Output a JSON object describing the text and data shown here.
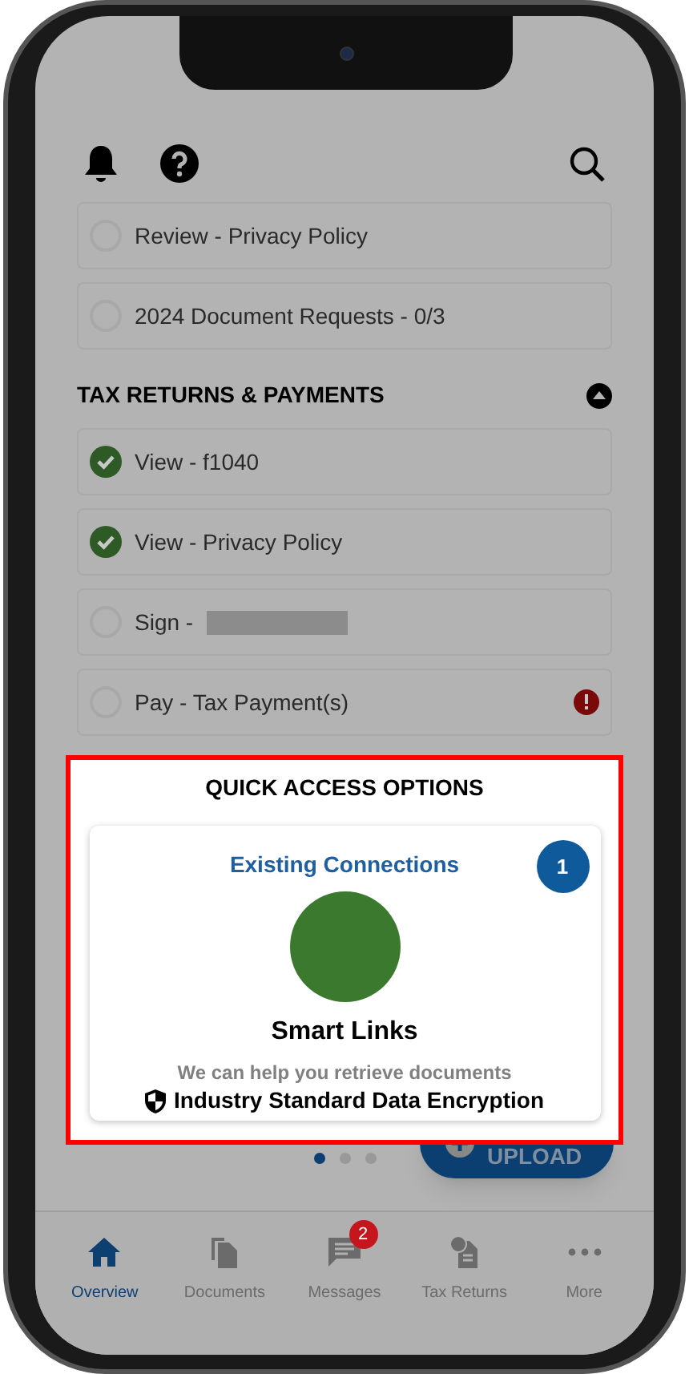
{
  "tasks": [
    {
      "label": "Review - Privacy Policy",
      "checked": false,
      "alert": false,
      "redacted": false
    },
    {
      "label": "2024 Document Requests - 0/3",
      "checked": false,
      "alert": false,
      "redacted": false
    }
  ],
  "section": {
    "title": "TAX RETURNS & PAYMENTS",
    "expanded": true,
    "items": [
      {
        "label": "View - f1040",
        "checked": true,
        "alert": false,
        "redacted": false
      },
      {
        "label": "View - Privacy Policy",
        "checked": true,
        "alert": false,
        "redacted": false
      },
      {
        "label": "Sign -",
        "checked": false,
        "alert": false,
        "redacted": true
      },
      {
        "label": "Pay - Tax Payment(s)",
        "checked": false,
        "alert": true,
        "redacted": false
      }
    ]
  },
  "quick_access": {
    "title": "QUICK ACCESS OPTIONS",
    "card": {
      "heading": "Existing Connections",
      "count": "1",
      "name": "Smart Links",
      "description": "We can help you retrieve documents",
      "security": "Industry Standard Data Encryption"
    },
    "pages": [
      {
        "selected": true
      },
      {
        "selected": false
      },
      {
        "selected": false
      }
    ]
  },
  "upload_button": "UPLOAD",
  "tabs": [
    {
      "label": "Overview",
      "kind": "home",
      "selected": true
    },
    {
      "label": "Documents",
      "kind": "docs",
      "selected": false
    },
    {
      "label": "Messages",
      "kind": "chat",
      "selected": false,
      "badge": "2"
    },
    {
      "label": "Tax Returns",
      "kind": "tax",
      "selected": false
    },
    {
      "label": "More",
      "kind": "more",
      "selected": false
    }
  ]
}
